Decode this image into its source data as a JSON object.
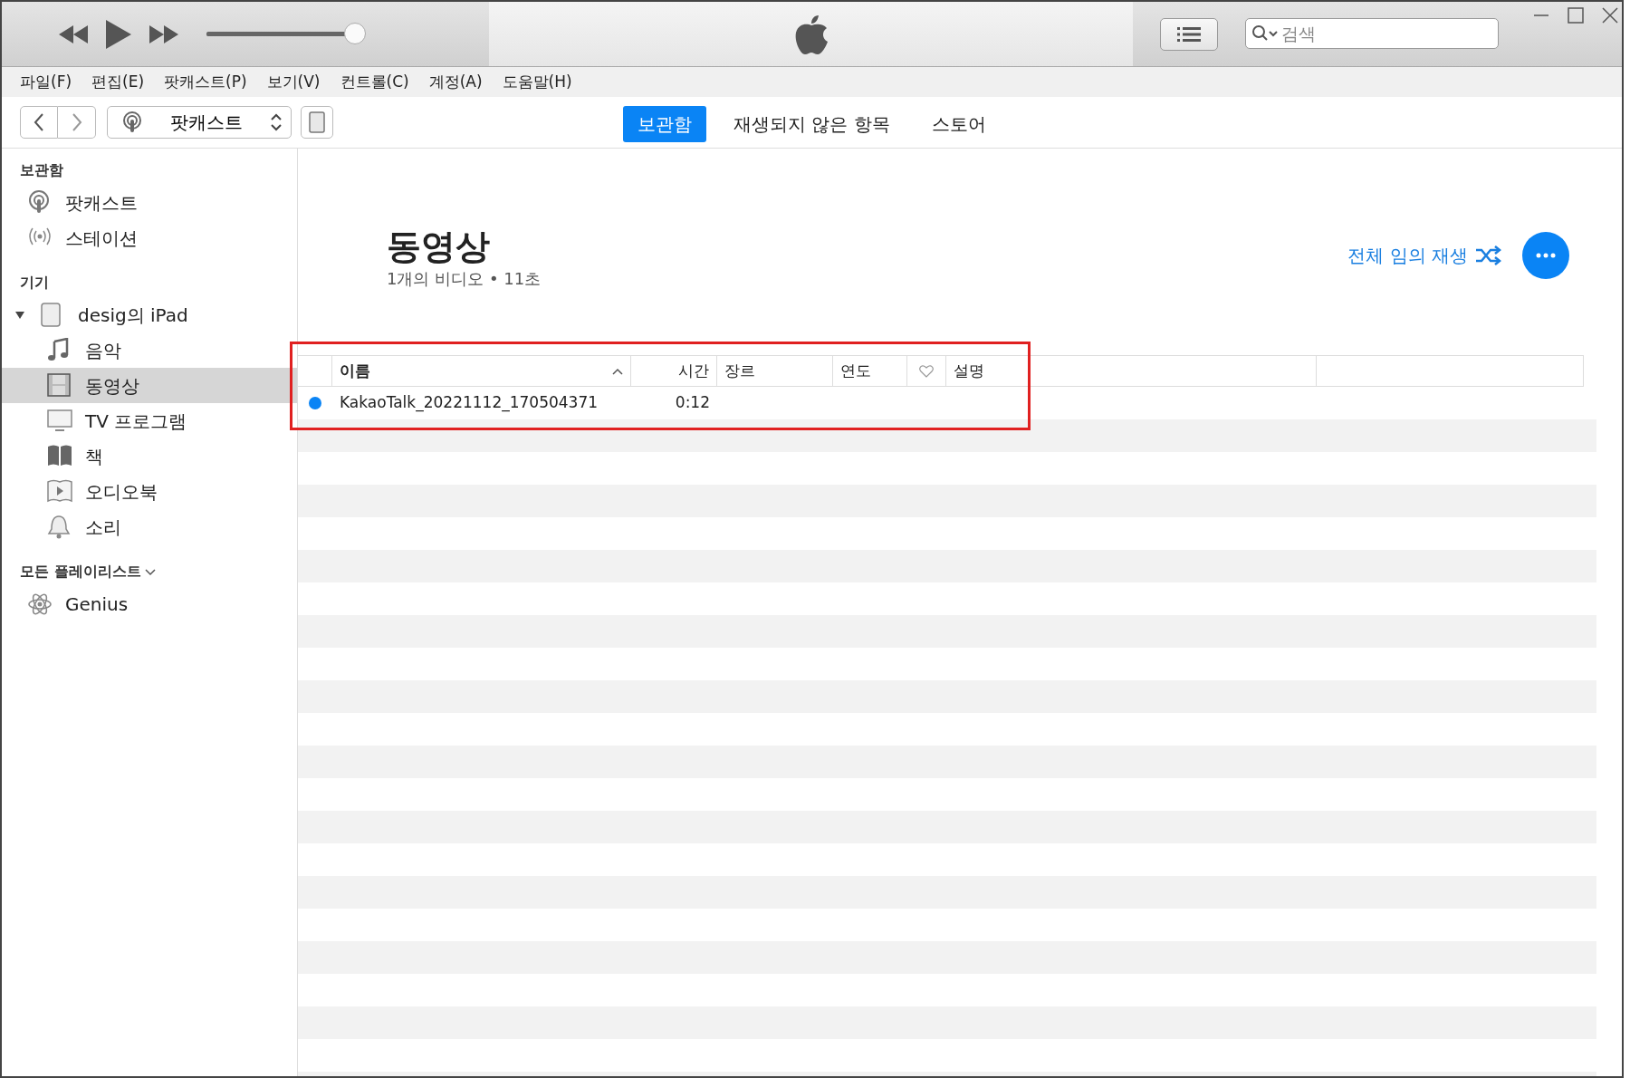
{
  "search": {
    "placeholder": "검색"
  },
  "menu": [
    "파일(F)",
    "편집(E)",
    "팟캐스트(P)",
    "보기(V)",
    "컨트롤(C)",
    "계정(A)",
    "도움말(H)"
  ],
  "media_picker": {
    "value": "팟캐스트"
  },
  "tabs": [
    {
      "label": "보관함",
      "selected": true
    },
    {
      "label": "재생되지 않은 항목",
      "selected": false
    },
    {
      "label": "스토어",
      "selected": false
    }
  ],
  "sidebar": [
    {
      "title": "보관함",
      "items": [
        {
          "label": "팟캐스트",
          "selected": false
        },
        {
          "label": "스테이션",
          "selected": false
        }
      ]
    },
    {
      "title": "기기",
      "items": [
        {
          "label": "desig의 iPad",
          "selected": false,
          "expanded": true,
          "children": [
            {
              "label": "음악",
              "selected": false
            },
            {
              "label": "동영상",
              "selected": true
            },
            {
              "label": "TV 프로그램",
              "selected": false
            },
            {
              "label": "책",
              "selected": false
            },
            {
              "label": "오디오북",
              "selected": false
            },
            {
              "label": "소리",
              "selected": false
            }
          ]
        }
      ]
    },
    {
      "title": "모든 플레이리스트",
      "collapsible": true,
      "items": [
        {
          "label": "Genius",
          "selected": false
        }
      ]
    }
  ],
  "header": {
    "title": "동영상",
    "subtitle": "1개의 비디오 • 11초",
    "shuffle": "전체 임의 재생"
  },
  "table": {
    "columns": [
      {
        "kind": "text",
        "label": "이름",
        "sorted": true
      },
      {
        "kind": "right",
        "label": "시간"
      },
      {
        "kind": "text",
        "label": "장르"
      },
      {
        "kind": "text",
        "label": "연도"
      },
      {
        "kind": "heart"
      },
      {
        "kind": "text",
        "label": "설명"
      }
    ],
    "rows": [
      {
        "unplayed": true,
        "cells": [
          "KakaoTalk_20221112_170504371",
          "0:12",
          "",
          "",
          "",
          ""
        ]
      }
    ]
  }
}
